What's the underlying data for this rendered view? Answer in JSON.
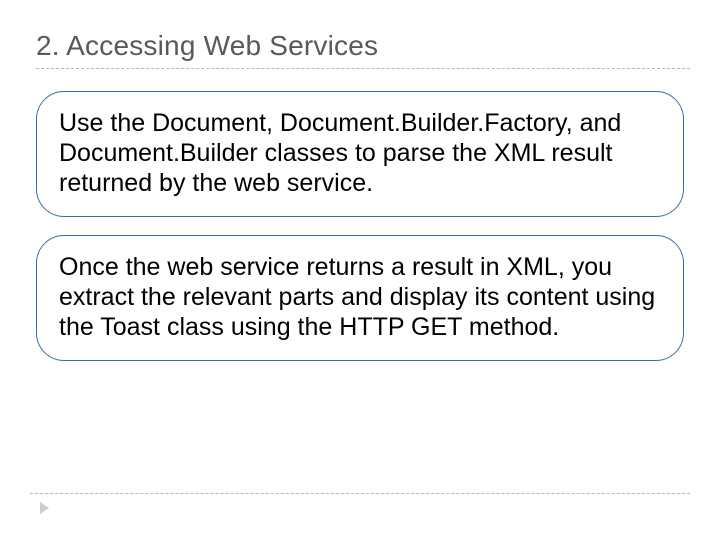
{
  "heading": {
    "text": "2. Accessing Web Services"
  },
  "boxes": [
    {
      "text": "Use the Document, Document.Builder.Factory, and Document.Builder classes to parse the XML result returned by the web service."
    },
    {
      "text": "Once the web service returns a result in XML, you extract the relevant parts and display its content using the Toast class using the HTTP GET method."
    }
  ]
}
